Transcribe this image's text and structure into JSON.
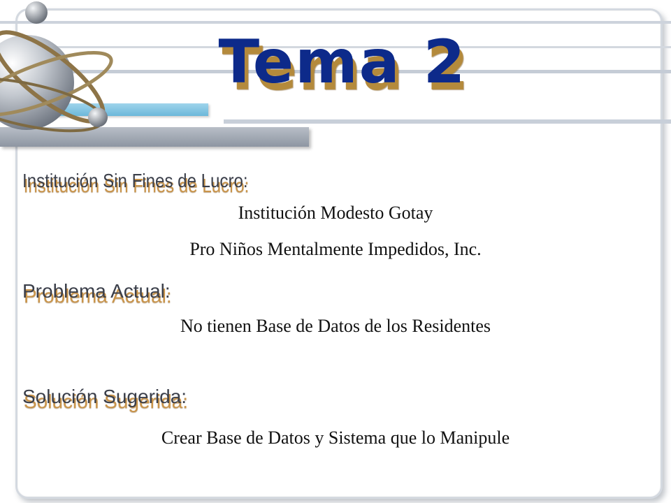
{
  "slide": {
    "title": "Tema 2",
    "sections": [
      {
        "heading": "Institución Sin Fines de Lucro:",
        "lines": [
          "Institución Modesto Gotay",
          "Pro Niños Mentalmente Impedidos, Inc."
        ]
      },
      {
        "heading": "Problema Actual:",
        "lines": [
          "No tienen Base de Datos de los Residentes"
        ]
      },
      {
        "heading": "Solución Sugerida:",
        "lines": [
          "Crear Base de Datos y Sistema que lo Manipule"
        ]
      }
    ]
  },
  "decoration": {
    "logo_icon": "atom-sphere-icon",
    "accent_blue": "#8ac8e4",
    "title_color": "#0d2a8a",
    "title_shadow_color": "#b48a3c"
  }
}
